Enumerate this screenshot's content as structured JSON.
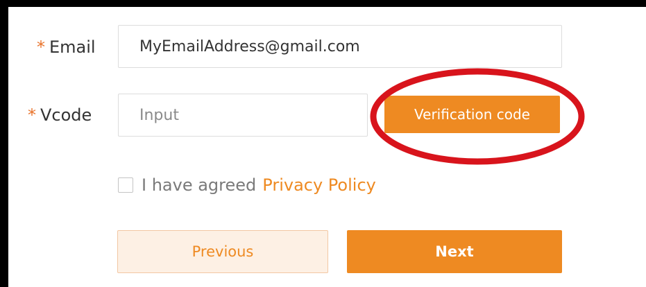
{
  "form": {
    "required_marker": "*",
    "email": {
      "label": "Email",
      "value": "MyEmailAddress@gmail.com"
    },
    "vcode": {
      "label": "Vcode",
      "placeholder": "Input",
      "button_label": "Verification code"
    },
    "agreement": {
      "checked": false,
      "text": "I have agreed",
      "link_text": "Privacy Policy"
    },
    "buttons": {
      "previous_label": "Previous",
      "next_label": "Next"
    }
  },
  "colors": {
    "accent": "#ee8a22",
    "annotation_circle": "#d8141c",
    "frame": "#000000"
  }
}
